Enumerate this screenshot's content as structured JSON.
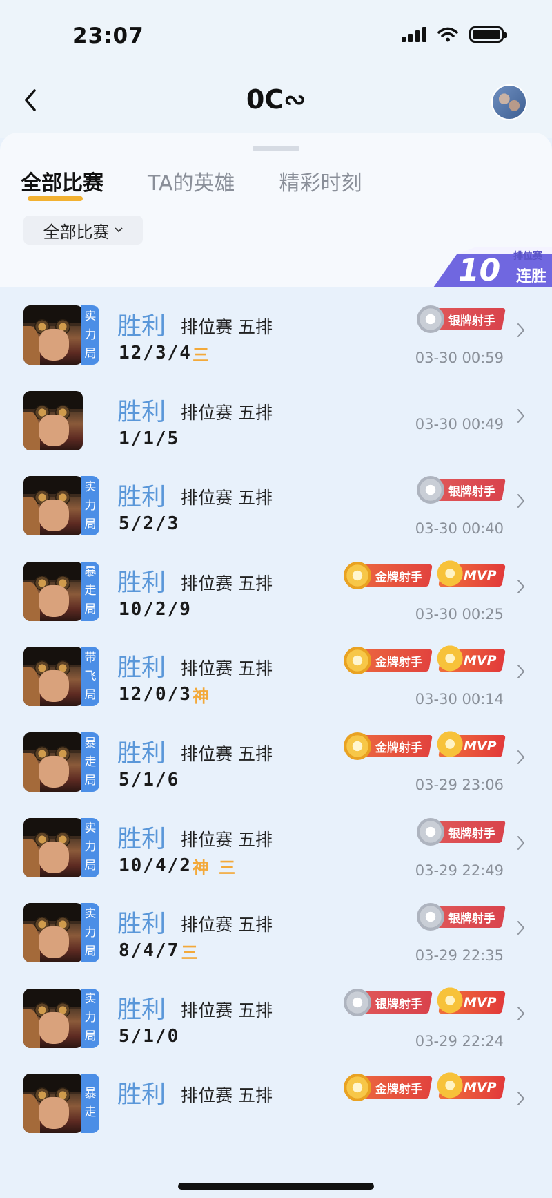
{
  "status": {
    "time": "23:07"
  },
  "nav": {
    "title": "0C∾"
  },
  "tabs": [
    {
      "label": "全部比赛"
    },
    {
      "label": "TA的英雄"
    },
    {
      "label": "精彩时刻"
    }
  ],
  "filter": {
    "label": "全部比赛"
  },
  "streak": {
    "number": "10",
    "small": "排位赛",
    "word": "连胜"
  },
  "matches": [
    {
      "tag": [
        "实",
        "力",
        "局"
      ],
      "result": "胜利",
      "mode": "排位赛 五排",
      "kda": "12/3/4",
      "marks": [
        "三"
      ],
      "badges": {
        "medal": "银牌射手",
        "medal_tier": "silver",
        "mvp": ""
      },
      "time": "03-30 00:59"
    },
    {
      "tag": [],
      "result": "胜利",
      "mode": "排位赛 五排",
      "kda": "1/1/5",
      "marks": [],
      "badges": {
        "medal": "",
        "medal_tier": "",
        "mvp": ""
      },
      "time": "03-30 00:49"
    },
    {
      "tag": [
        "实",
        "力",
        "局"
      ],
      "result": "胜利",
      "mode": "排位赛 五排",
      "kda": "5/2/3",
      "marks": [],
      "badges": {
        "medal": "银牌射手",
        "medal_tier": "silver",
        "mvp": ""
      },
      "time": "03-30 00:40"
    },
    {
      "tag": [
        "暴",
        "走",
        "局"
      ],
      "result": "胜利",
      "mode": "排位赛 五排",
      "kda": "10/2/9",
      "marks": [],
      "badges": {
        "medal": "金牌射手",
        "medal_tier": "gold",
        "mvp": "MVP"
      },
      "time": "03-30 00:25"
    },
    {
      "tag": [
        "带",
        "飞",
        "局"
      ],
      "result": "胜利",
      "mode": "排位赛 五排",
      "kda": "12/0/3",
      "marks": [
        "神"
      ],
      "badges": {
        "medal": "金牌射手",
        "medal_tier": "gold",
        "mvp": "MVP"
      },
      "time": "03-30 00:14"
    },
    {
      "tag": [
        "暴",
        "走",
        "局"
      ],
      "result": "胜利",
      "mode": "排位赛 五排",
      "kda": "5/1/6",
      "marks": [],
      "badges": {
        "medal": "金牌射手",
        "medal_tier": "gold",
        "mvp": "MVP"
      },
      "time": "03-29 23:06"
    },
    {
      "tag": [
        "实",
        "力",
        "局"
      ],
      "result": "胜利",
      "mode": "排位赛 五排",
      "kda": "10/4/2",
      "marks": [
        "神",
        "三"
      ],
      "badges": {
        "medal": "银牌射手",
        "medal_tier": "silver",
        "mvp": ""
      },
      "time": "03-29 22:49"
    },
    {
      "tag": [
        "实",
        "力",
        "局"
      ],
      "result": "胜利",
      "mode": "排位赛 五排",
      "kda": "8/4/7",
      "marks": [
        "三"
      ],
      "badges": {
        "medal": "银牌射手",
        "medal_tier": "silver",
        "mvp": ""
      },
      "time": "03-29 22:35"
    },
    {
      "tag": [
        "实",
        "力",
        "局"
      ],
      "result": "胜利",
      "mode": "排位赛 五排",
      "kda": "5/1/0",
      "marks": [],
      "badges": {
        "medal": "银牌射手",
        "medal_tier": "silver",
        "mvp": "MVP"
      },
      "time": "03-29 22:24"
    },
    {
      "tag": [
        "暴",
        "走"
      ],
      "result": "胜利",
      "mode": "排位赛 五排",
      "kda": "",
      "marks": [],
      "badges": {
        "medal": "金牌射手",
        "medal_tier": "gold",
        "mvp": "MVP"
      },
      "time": ""
    }
  ],
  "colors": {
    "win": "#5a97d9",
    "accent": "#f2b131",
    "tag": "#4b8ee6",
    "list_bg": "#e8f1fb"
  }
}
